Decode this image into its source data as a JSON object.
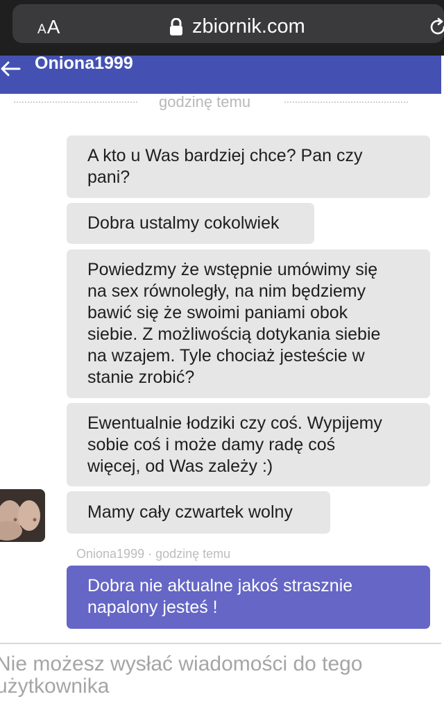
{
  "browser": {
    "text_size_label_small": "A",
    "text_size_label_large": "A",
    "domain": "zbiornik.com"
  },
  "header": {
    "username": "Oniona1999"
  },
  "separator": {
    "label": "godzinę temu"
  },
  "messages": [
    {
      "lines": [
        "A kto u Was bardziej chce? Pan czy",
        "pani?"
      ]
    },
    {
      "lines": [
        "Dobra ustalmy cokolwiek"
      ]
    },
    {
      "lines": [
        "Powiedzmy że wstępnie umówimy się",
        "na sex równoległy, na nim będziemy",
        "bawić się że swoimi paniami obok",
        "siebie. Z możliwością dotykania siebie",
        "na wzajem. Tyle chociaż jesteście w",
        "stanie zrobić?"
      ]
    },
    {
      "lines": [
        "Ewentualnie łodziki czy coś. Wypijemy",
        "sobie coś i może damy radę coś",
        "więcej, od Was zależy :)"
      ]
    },
    {
      "lines": [
        "Mamy cały czwartek wolny"
      ]
    }
  ],
  "last_meta": "Oniona1999 · godzinę temu",
  "own_message": {
    "lines": [
      "Dobra nie aktualne jakoś strasznie",
      "napalony jesteś !"
    ]
  },
  "footer": {
    "lines": [
      "Nie możesz wysłać wiadomości do tego",
      "użytkownika"
    ]
  },
  "colors": {
    "header_bg": "#4451b3",
    "own_bubble": "#6566c5",
    "other_bubble": "#e6e6e6"
  }
}
